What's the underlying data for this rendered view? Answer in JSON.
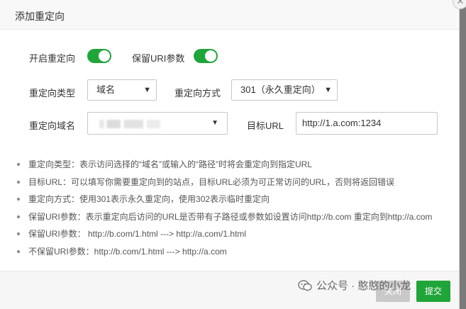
{
  "dialog": {
    "title": "添加重定向"
  },
  "form": {
    "open_redirect_label": "开启重定向",
    "keep_uri_label": "保留URI参数",
    "redirect_type_label": "重定向类型",
    "redirect_type_value": "域名",
    "redirect_mode_label": "重定向方式",
    "redirect_mode_value": "301（永久重定向）",
    "redirect_domain_label": "重定向域名",
    "target_url_label": "目标URL",
    "target_url_value": "http://1.a.com:1234"
  },
  "tips": [
    "重定向类型：表示访问选择的“域名”或输入的“路径”时将会重定向到指定URL",
    "目标URL：可以填写你需要重定向到的站点，目标URL必须为可正常访问的URL，否则将返回错误",
    "重定向方式：使用301表示永久重定向，使用302表示临时重定向",
    "保留URI参数：表示重定向后访问的URL是否带有子路径或参数如设置访问http://b.com 重定向到http://a.com",
    "保留URI参数： http://b.com/1.html ---> http://a.com/1.html",
    "不保留URI参数：http://b.com/1.html ---> http://a.com"
  ],
  "footer": {
    "close_label": "关闭",
    "submit_label": "提交"
  },
  "watermark": {
    "text": "公众号 · 憨憨的小龙"
  },
  "icons": {
    "close": "close-icon",
    "dropdown": "chevron-down-icon",
    "wechat": "wechat-icon"
  },
  "colors": {
    "accent": "#20a53a"
  }
}
